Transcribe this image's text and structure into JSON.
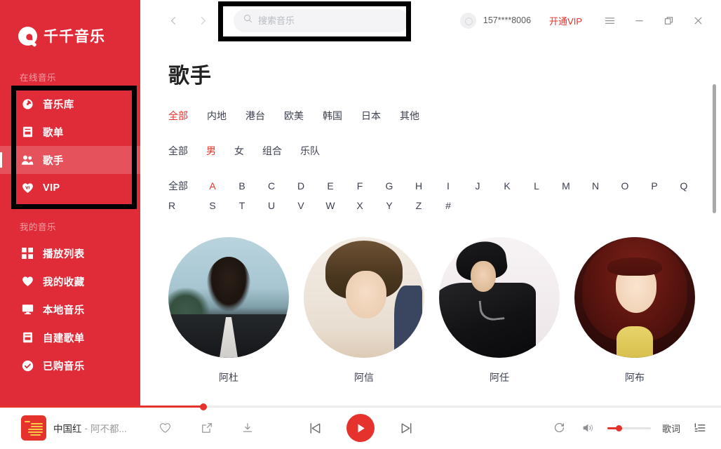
{
  "app": {
    "name": "千千音乐",
    "logo_icon": "qianqian-logo-icon"
  },
  "sidebar": {
    "groups": [
      {
        "label": "在线音乐"
      },
      {
        "label": "我的音乐"
      }
    ],
    "online_items": [
      {
        "label": "音乐库",
        "icon": "disc-icon",
        "active": false
      },
      {
        "label": "歌单",
        "icon": "playlist-book-icon",
        "active": false
      },
      {
        "label": "歌手",
        "icon": "people-icon",
        "active": true
      },
      {
        "label": "VIP",
        "icon": "vip-heart-icon",
        "active": false
      }
    ],
    "mine_items": [
      {
        "label": "播放列表",
        "icon": "grid-icon"
      },
      {
        "label": "我的收藏",
        "icon": "heart-icon"
      },
      {
        "label": "本地音乐",
        "icon": "monitor-icon"
      },
      {
        "label": "自建歌单",
        "icon": "note-book-icon"
      },
      {
        "label": "已购音乐",
        "icon": "check-circle-icon"
      }
    ]
  },
  "header": {
    "back_icon": "chevron-left-icon",
    "forward_icon": "chevron-right-icon",
    "search": {
      "icon": "search-icon",
      "value": "",
      "placeholder": "搜索音乐"
    },
    "avatar_icon": "user-avatar-icon",
    "username": "157****8006",
    "vip_label": "开通VIP",
    "menu_icon": "hamburger-menu-icon",
    "minimize_icon": "minimize-icon",
    "maximize_icon": "restore-window-icon",
    "close_icon": "close-icon"
  },
  "main": {
    "title": "歌手",
    "filters": {
      "region": {
        "items": [
          "全部",
          "内地",
          "港台",
          "欧美",
          "韩国",
          "日本",
          "其他"
        ],
        "active": "全部"
      },
      "gender": {
        "items": [
          "全部",
          "男",
          "女",
          "组合",
          "乐队"
        ],
        "active": "男"
      },
      "alpha_row1": {
        "items": [
          "全部",
          "A",
          "B",
          "C",
          "D",
          "E",
          "F",
          "G",
          "H",
          "I",
          "J",
          "K",
          "L",
          "M",
          "N",
          "O",
          "P",
          "Q"
        ],
        "active": "A"
      },
      "alpha_row2": {
        "items": [
          "R",
          "S",
          "T",
          "U",
          "V",
          "W",
          "X",
          "Y",
          "Z",
          "#"
        ],
        "active": ""
      }
    },
    "artists": [
      {
        "name": "阿杜",
        "photo_class": "ph1"
      },
      {
        "name": "阿信",
        "photo_class": "ph2"
      },
      {
        "name": "阿任",
        "photo_class": "ph3"
      },
      {
        "name": "阿布",
        "photo_class": "ph4"
      }
    ]
  },
  "player": {
    "album_art_icon": "album-cover-icon",
    "song_title": "中国红",
    "separator": "-",
    "artist": "阿不都...",
    "like_icon": "heart-outline-icon",
    "share_icon": "share-icon",
    "download_icon": "download-icon",
    "prev_icon": "previous-track-icon",
    "play_icon": "play-icon",
    "next_icon": "next-track-icon",
    "repeat_icon": "repeat-icon",
    "volume_icon": "volume-icon",
    "lyric_label": "歌词",
    "playlist_icon": "playlist-queue-icon",
    "progress_percent": 28,
    "volume_percent": 26
  },
  "colors": {
    "brand_red": "#e02c39",
    "accent_red": "#e5322c",
    "sidebar_text": "#ffffff",
    "group_label": "#f2a1a6",
    "highlight_box": "#000000"
  },
  "scrollbar": {
    "thumb_color": "#a8a8ab"
  }
}
